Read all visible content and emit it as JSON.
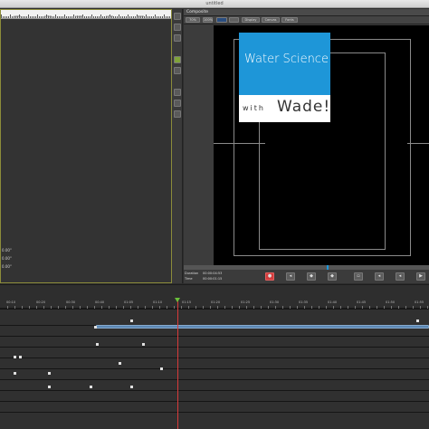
{
  "window": {
    "title": "untitled"
  },
  "left_panel": {
    "ruler_labels": [
      "1000",
      "1250",
      "1500",
      "1750",
      "2000"
    ],
    "coordinates": [
      "0.00\"",
      "0.00\"",
      "0.00\""
    ]
  },
  "composite": {
    "title": "Composite",
    "toolbar": {
      "zoom": "70%",
      "percent": "100%",
      "buttons": [
        "Display",
        "Canvas",
        "Fonts"
      ]
    },
    "title_card": {
      "line1": "Water Science",
      "line2_prefix": "with",
      "line2_name": "Wade!"
    },
    "transport": {
      "duration_label": "Duration",
      "duration_value": "00:00:04:53",
      "time_label": "Time",
      "time_value": "00:00:01:15"
    }
  },
  "timeline": {
    "ruler_labels": [
      "00:10",
      "00:20",
      "00:30",
      "00:40",
      "01:05",
      "01:10",
      "01:15",
      "01:20",
      "01:25",
      "01:30",
      "01:35",
      "01:40",
      "01:45",
      "01:50",
      "01:55"
    ]
  }
}
